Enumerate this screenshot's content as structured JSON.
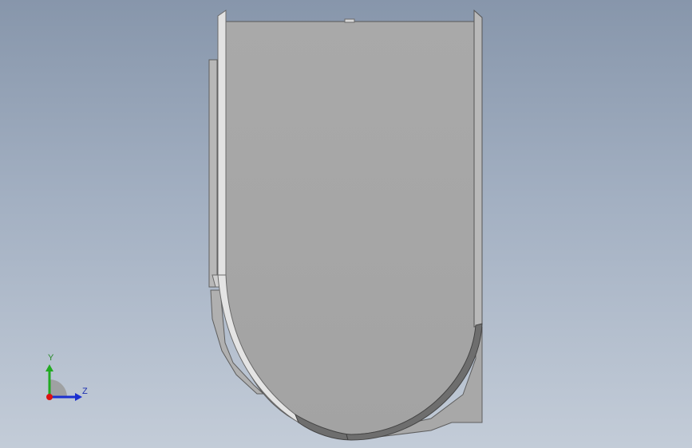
{
  "viewport": {
    "background_top": "#8796ab",
    "background_bottom": "#c3ccd8"
  },
  "model": {
    "face_color": "#a6a6a6",
    "rim_light_color": "#e3e3e3",
    "rim_dark_color": "#5a5a5a",
    "flange_color": "#b9b9b9"
  },
  "triad": {
    "y_label": "Y",
    "z_label": "Z",
    "y_color": "#22aa22",
    "z_color": "#1a2fd0",
    "x_color": "#dd1111"
  }
}
